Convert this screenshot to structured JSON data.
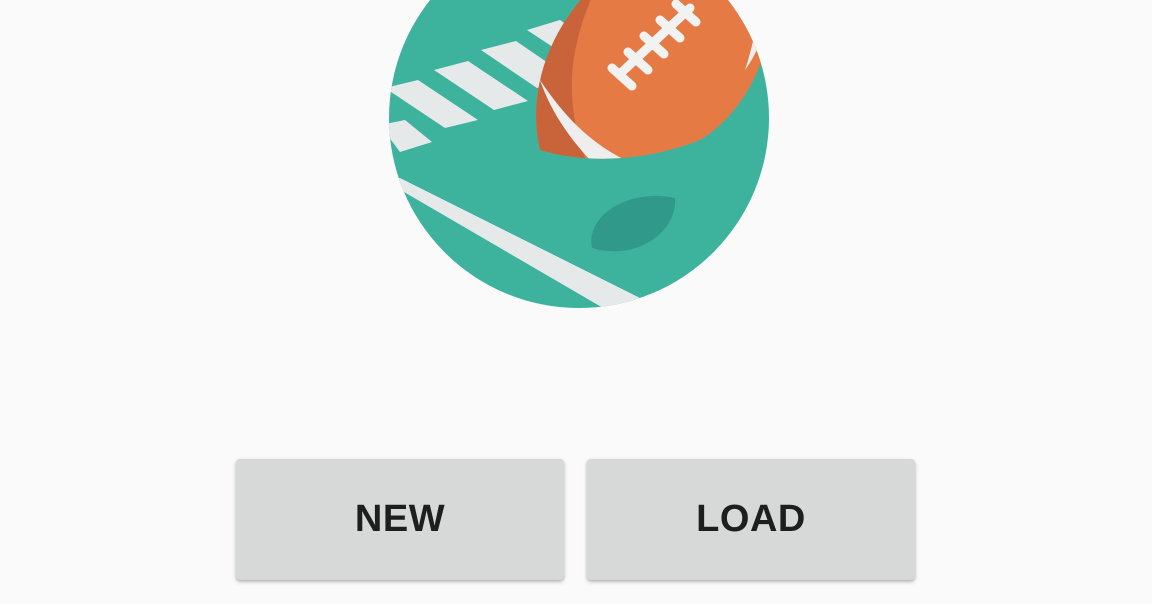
{
  "logo": {
    "icon": "football-field-logo",
    "colors": {
      "field": "#3db39e",
      "field_dark": "#31998a",
      "stripes": "#e6e9ea",
      "ball": "#e67a44",
      "ball_shade": "#c9633a",
      "laces": "#f1f2f2"
    }
  },
  "actions": {
    "new_label": "NEW",
    "load_label": "LOAD"
  },
  "theme": {
    "background": "#fafafa",
    "button_bg": "#d7d9d9",
    "button_text": "#1e1e1e"
  }
}
